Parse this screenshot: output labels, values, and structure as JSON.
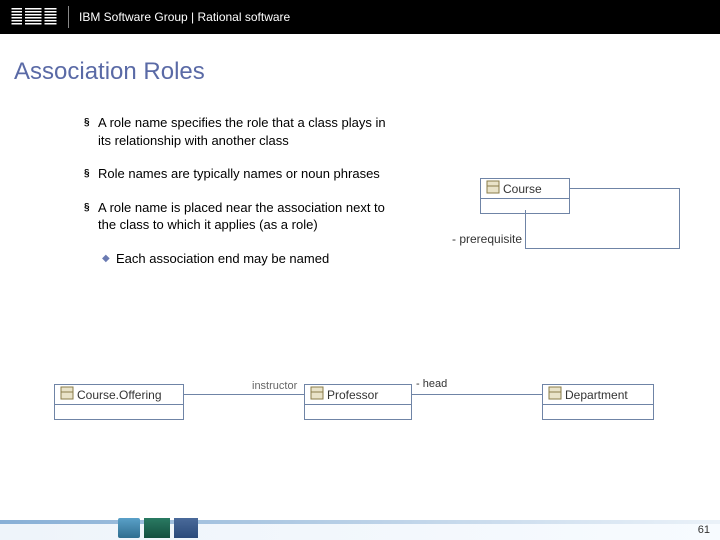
{
  "header": {
    "logo_text": "IBM",
    "text": "IBM Software Group | Rational software"
  },
  "title": "Association Roles",
  "bullets": [
    {
      "text": "A role name specifies the role that a class plays in its relationship with another class"
    },
    {
      "text": "Role names are typically names or noun phrases"
    },
    {
      "text": "A role name is placed near the association next to the class to which it applies (as a role)",
      "sub": [
        {
          "text": "Each association end may be named"
        }
      ]
    }
  ],
  "diagram_top": {
    "class_name": "Course",
    "role_label": "- prerequisite"
  },
  "diagram_bottom": {
    "class1": "Course.Offering",
    "role1_right": "instructor",
    "class2": "Professor",
    "role2_right": "- head",
    "class3": "Department"
  },
  "page_number": "61"
}
